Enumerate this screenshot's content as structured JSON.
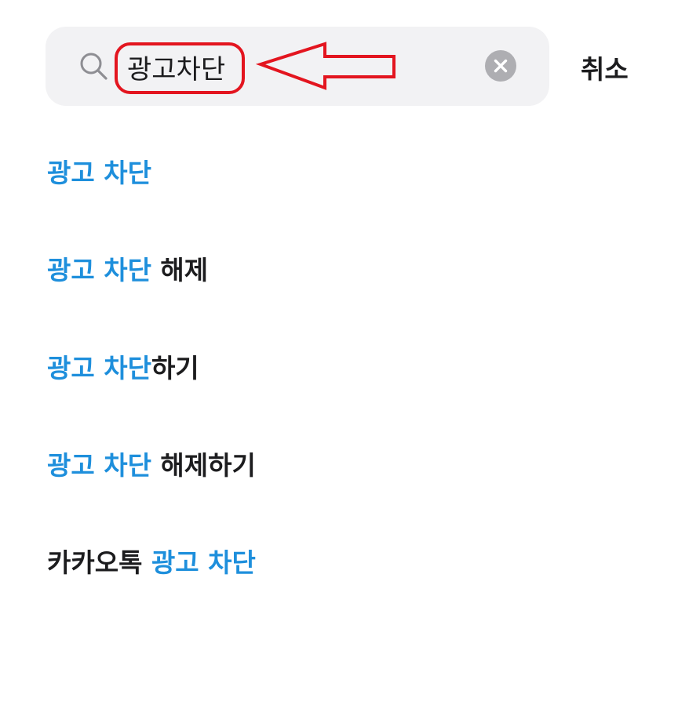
{
  "search": {
    "query": "광고차단",
    "cancel_label": "취소"
  },
  "colors": {
    "highlight": "#1e8fdc",
    "annotation": "#e3151f",
    "search_bg": "#f2f2f4"
  },
  "suggestions": [
    {
      "pre": "",
      "match": "광고 차단",
      "post": ""
    },
    {
      "pre": "",
      "match": "광고 차단",
      "post": " 해제"
    },
    {
      "pre": "",
      "match": "광고 차단",
      "post": "하기"
    },
    {
      "pre": "",
      "match": "광고 차단",
      "post": " 해제하기"
    },
    {
      "pre": "카카오톡 ",
      "match": "광고 차단",
      "post": ""
    }
  ]
}
